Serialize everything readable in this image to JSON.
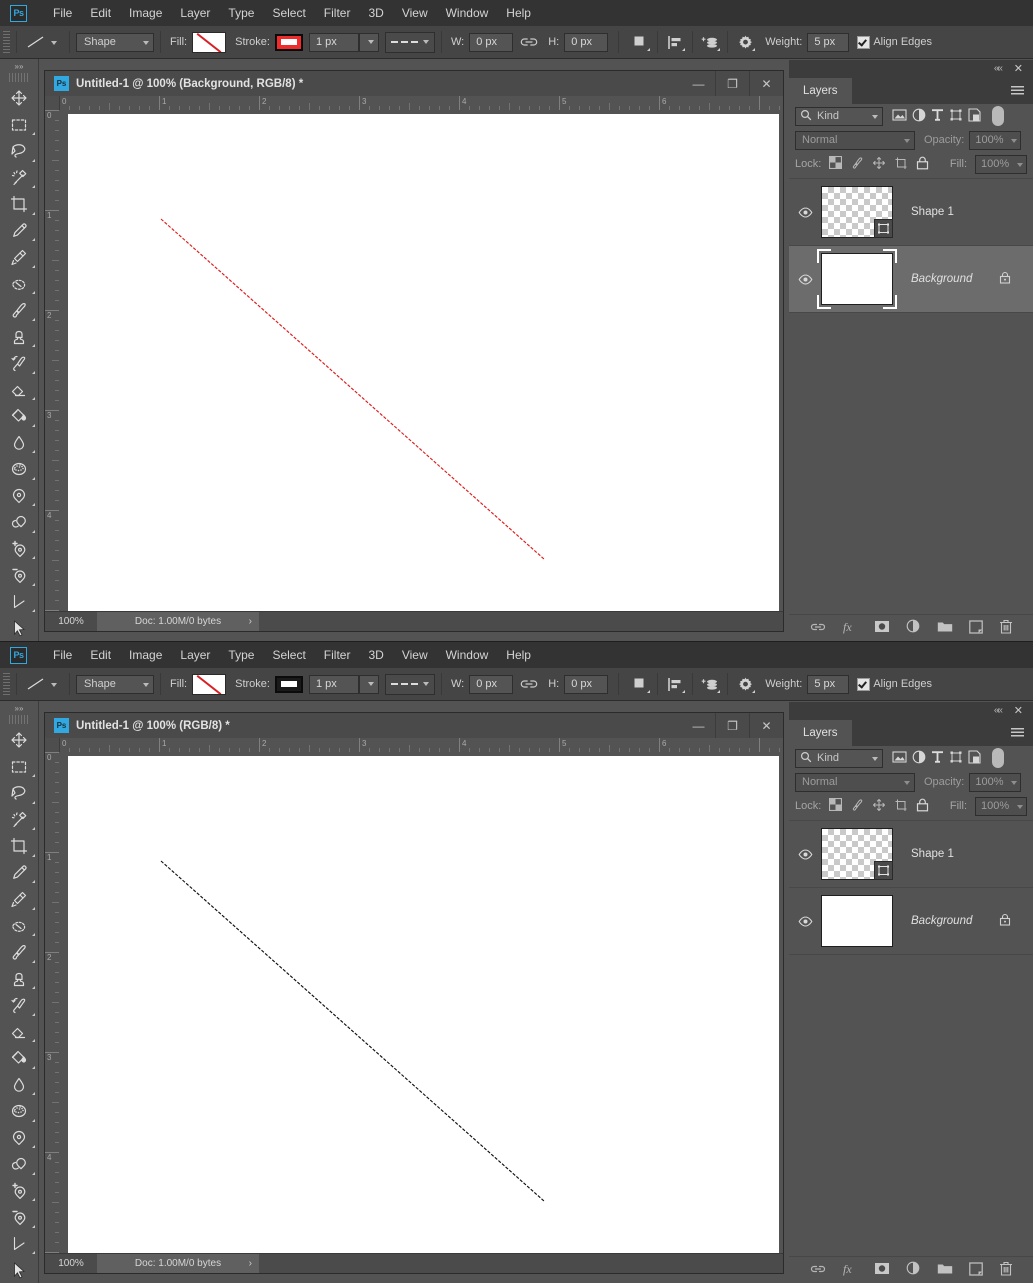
{
  "app": {
    "logo": "Ps",
    "name": "Adobe Photoshop"
  },
  "menu": {
    "items": [
      "File",
      "Edit",
      "Image",
      "Layer",
      "Type",
      "Select",
      "Filter",
      "3D",
      "View",
      "Window",
      "Help"
    ]
  },
  "options_bar": {
    "tool_icon": "line-tool-icon",
    "mode_value": "Shape",
    "fill_label": "Fill:",
    "fill_value": "none",
    "stroke_label": "Stroke:",
    "stroke_width_value": "1 px",
    "dash_style": "dashed",
    "w_label": "W:",
    "w_value": "0 px",
    "link_icon": "link-icon",
    "h_label": "H:",
    "h_value": "0 px",
    "path_ops_icon": "path-operations-icon",
    "align_icon": "path-alignment-icon",
    "arrange_icon": "path-arrangement-icon",
    "gear_icon": "gear-icon",
    "weight_label": "Weight:",
    "weight_value": "5 px",
    "align_edges_label": "Align Edges",
    "align_edges_checked": true
  },
  "toolbar": {
    "collapse_icon": "double-chevron-right-icon",
    "tools": [
      {
        "name": "move-tool",
        "icon": "move-icon"
      },
      {
        "name": "rectangular-marquee-tool",
        "icon": "marquee-icon"
      },
      {
        "name": "lasso-tool",
        "icon": "lasso-icon"
      },
      {
        "name": "quick-selection-tool",
        "icon": "magic-wand-icon"
      },
      {
        "name": "crop-tool",
        "icon": "crop-icon"
      },
      {
        "name": "eyedropper-tool",
        "icon": "eyedropper-icon"
      },
      {
        "name": "healing-brush-tool",
        "icon": "healing-brush-icon"
      },
      {
        "name": "patch-tool",
        "icon": "patch-icon"
      },
      {
        "name": "brush-tool",
        "icon": "brush-icon"
      },
      {
        "name": "clone-stamp-tool",
        "icon": "stamp-icon"
      },
      {
        "name": "history-brush-tool",
        "icon": "history-brush-icon"
      },
      {
        "name": "eraser-tool",
        "icon": "eraser-icon"
      },
      {
        "name": "gradient-tool",
        "icon": "paint-bucket-icon"
      },
      {
        "name": "blur-tool",
        "icon": "blur-drop-icon"
      },
      {
        "name": "dodge-tool",
        "icon": "sponge-icon"
      },
      {
        "name": "pen-tool",
        "icon": "pen-icon"
      },
      {
        "name": "freeform-pen-tool",
        "icon": "freeform-pen-icon"
      },
      {
        "name": "add-anchor-point-tool",
        "icon": "add-anchor-pen-icon"
      },
      {
        "name": "delete-anchor-point-tool",
        "icon": "delete-anchor-pen-icon"
      },
      {
        "name": "path-selection-tool",
        "icon": "path-corner-icon"
      },
      {
        "name": "direct-selection-tool",
        "icon": "arrow-cursor-icon"
      }
    ]
  },
  "windows": [
    {
      "id": "top",
      "title": "Untitled-1 @ 100% (Background, RGB/8) *",
      "stroke_color": "#ef2b2b",
      "stroke_swatch_border": "#0b0b0b",
      "line_color": "#e01b1b",
      "minimize_icon": "minimize-icon",
      "maximize_icon": "maximize-icon",
      "close_icon": "close-icon",
      "ruler_h_labels": [
        "0",
        "1",
        "2",
        "3",
        "4",
        "5",
        "6"
      ],
      "ruler_v_labels": [
        "0",
        "1",
        "2",
        "3",
        "4"
      ],
      "status": {
        "zoom": "100%",
        "doc_info": "Doc: 1.00M/0 bytes",
        "expand_icon": "chevron-right-icon"
      },
      "layers_panel": {
        "collapse_icon": "double-chevron-left-icon",
        "close_icon": "close-icon",
        "tab_label": "Layers",
        "menu_icon": "panel-menu-icon",
        "filter_label": "Kind",
        "search_icon": "search-icon",
        "filter_icons": [
          "pixel-layer-filter-icon",
          "adjustment-layer-filter-icon",
          "type-layer-filter-icon",
          "shape-layer-filter-icon",
          "smart-object-filter-icon"
        ],
        "filter_toggle": "filter-toggle-pill",
        "blend_mode": "Normal",
        "opacity_label": "Opacity:",
        "opacity_value": "100%",
        "lock_label": "Lock:",
        "lock_icons": [
          "lock-transparent-pixels-icon",
          "lock-image-pixels-icon",
          "lock-position-icon",
          "lock-artboard-nesting-icon",
          "lock-all-icon"
        ],
        "fill_label": "Fill:",
        "fill_value": "100%",
        "layers": [
          {
            "name": "Shape 1",
            "thumb": "transparent",
            "badge": "vector-mask-icon",
            "visible": true,
            "selected": false,
            "locked": false,
            "italic": false
          },
          {
            "name": "Background",
            "thumb": "white",
            "badge": null,
            "visible": true,
            "selected": true,
            "locked": true,
            "italic": true
          }
        ],
        "bottom_icons": [
          "link-layers-icon",
          "add-layer-style-icon",
          "add-layer-mask-icon",
          "new-adjustment-layer-icon",
          "new-group-icon",
          "new-layer-icon",
          "delete-layer-icon"
        ]
      }
    },
    {
      "id": "bottom",
      "title": "Untitled-1 @ 100% (RGB/8) *",
      "stroke_color": "#1a1a1a",
      "stroke_swatch_border": "#0b0b0b",
      "line_color": "#111111",
      "minimize_icon": "minimize-icon",
      "maximize_icon": "maximize-icon",
      "close_icon": "close-icon",
      "ruler_h_labels": [
        "0",
        "1",
        "2",
        "3",
        "4",
        "5",
        "6"
      ],
      "ruler_v_labels": [
        "0",
        "1",
        "2",
        "3",
        "4"
      ],
      "status": {
        "zoom": "100%",
        "doc_info": "Doc: 1.00M/0 bytes",
        "expand_icon": "chevron-right-icon"
      },
      "layers_panel": {
        "collapse_icon": "double-chevron-left-icon",
        "close_icon": "close-icon",
        "tab_label": "Layers",
        "menu_icon": "panel-menu-icon",
        "filter_label": "Kind",
        "search_icon": "search-icon",
        "filter_icons": [
          "pixel-layer-filter-icon",
          "adjustment-layer-filter-icon",
          "type-layer-filter-icon",
          "shape-layer-filter-icon",
          "smart-object-filter-icon"
        ],
        "filter_toggle": "filter-toggle-pill",
        "blend_mode": "Normal",
        "opacity_label": "Opacity:",
        "opacity_value": "100%",
        "lock_label": "Lock:",
        "lock_icons": [
          "lock-transparent-pixels-icon",
          "lock-image-pixels-icon",
          "lock-position-icon",
          "lock-artboard-nesting-icon",
          "lock-all-icon"
        ],
        "fill_label": "Fill:",
        "fill_value": "100%",
        "layers": [
          {
            "name": "Shape 1",
            "thumb": "transparent",
            "badge": "vector-mask-icon",
            "visible": true,
            "selected": false,
            "locked": false,
            "italic": false
          },
          {
            "name": "Background",
            "thumb": "white",
            "badge": null,
            "visible": true,
            "selected": false,
            "locked": true,
            "italic": true
          }
        ],
        "bottom_icons": [
          "link-layers-icon",
          "add-layer-style-icon",
          "add-layer-mask-icon",
          "new-adjustment-layer-icon",
          "new-group-icon",
          "new-layer-icon",
          "delete-layer-icon"
        ]
      }
    }
  ],
  "colors": {
    "accent": "#31a8e0",
    "panel_bg": "#535353",
    "menu_bg": "#333333",
    "options_bg": "#454545",
    "canvas_white": "#ffffff"
  }
}
